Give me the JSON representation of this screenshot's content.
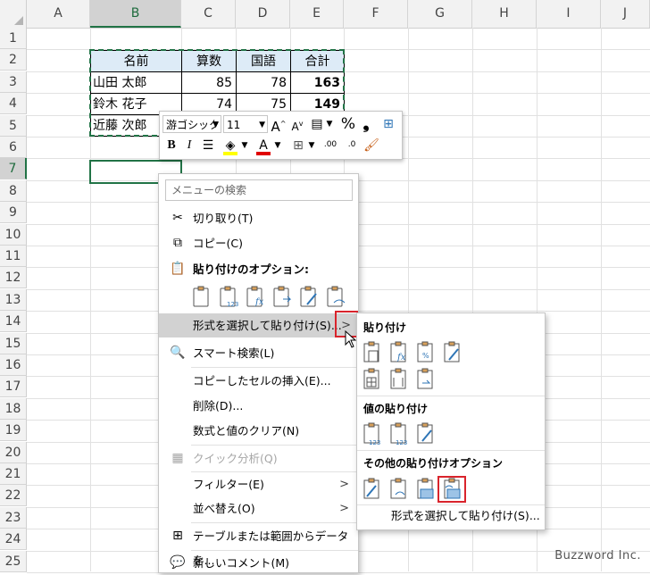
{
  "columns": [
    "A",
    "B",
    "C",
    "D",
    "E",
    "F",
    "G",
    "H",
    "I",
    "J"
  ],
  "rows": [
    "1",
    "2",
    "3",
    "4",
    "5",
    "6",
    "7",
    "8",
    "9",
    "10",
    "11",
    "12",
    "13",
    "14",
    "15",
    "16",
    "17",
    "18",
    "19",
    "20",
    "21",
    "22",
    "23",
    "24",
    "25"
  ],
  "table": {
    "headers": [
      "名前",
      "算数",
      "国語",
      "合計"
    ],
    "rows": [
      {
        "name": "山田 太郎",
        "math": "85",
        "lang": "78",
        "total": "163"
      },
      {
        "name": "鈴木 花子",
        "math": "74",
        "lang": "75",
        "total": "149"
      },
      {
        "name": "近藤 次郎",
        "math": "",
        "lang": "",
        "total": ""
      }
    ]
  },
  "mini_toolbar": {
    "font_name": "游ゴシック",
    "font_size": "11",
    "grow_font": "A",
    "shrink_font": "A",
    "percent": "%",
    "comma": "❟",
    "bold": "B",
    "italic": "I",
    "font_color_letter": "A",
    "dec_inc": ".00",
    "dec_dec": ".0"
  },
  "context_menu": {
    "search_placeholder": "メニューの検索",
    "items": {
      "cut": "切り取り(T)",
      "copy": "コピー(C)",
      "paste_options": "貼り付けのオプション:",
      "paste_special": "形式を選択して貼り付け(S)...",
      "smart_lookup": "スマート検索(L)",
      "insert_copied": "コピーしたセルの挿入(E)...",
      "delete": "削除(D)...",
      "clear": "数式と値のクリア(N)",
      "quick_analysis": "クイック分析(Q)",
      "filter": "フィルター(E)",
      "sort": "並べ替え(O)",
      "table_range": "テーブルまたは範囲からデータを...",
      "new_comment": "新しいコメント(M)"
    }
  },
  "submenu": {
    "paste_header": "貼り付け",
    "values_header": "値の貼り付け",
    "other_header": "その他の貼り付けオプション",
    "paste_special": "形式を選択して貼り付け(S)..."
  },
  "watermark": "Buzzword Inc.",
  "colors": {
    "accent": "#217346",
    "header_fill": "#ddebf7",
    "highlight_red": "#d9242c"
  }
}
